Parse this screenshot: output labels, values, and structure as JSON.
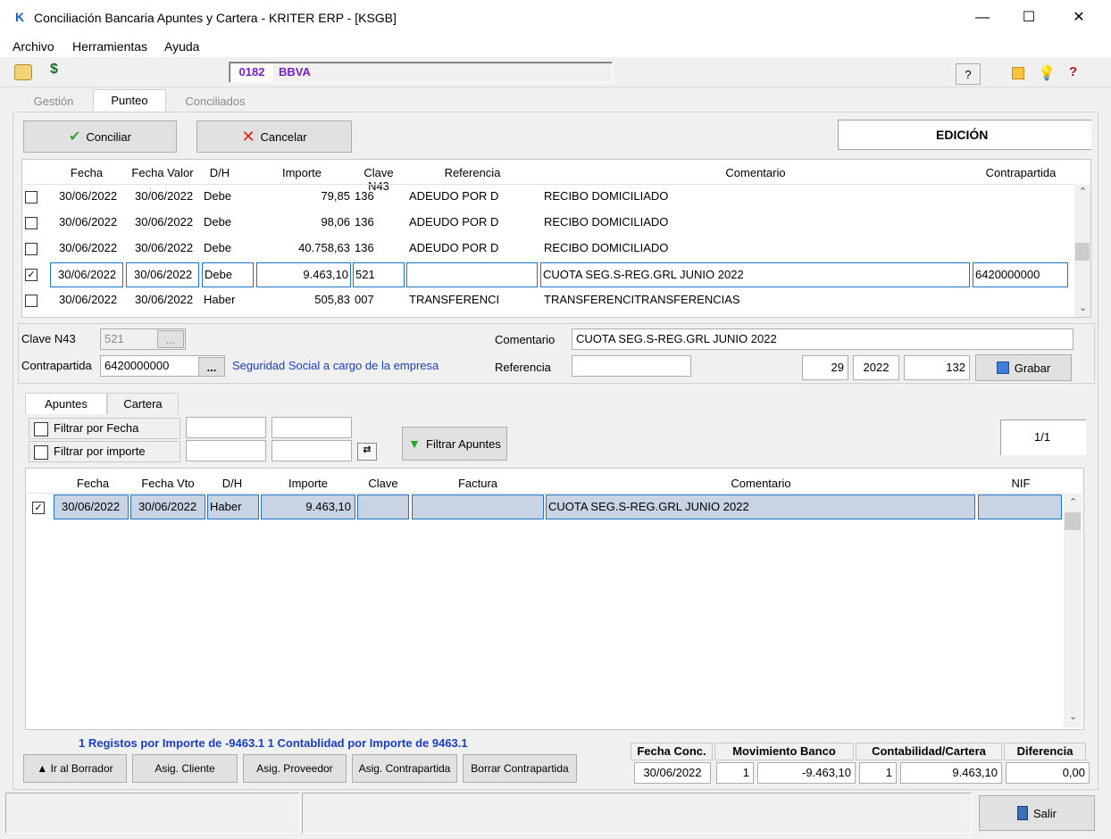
{
  "window": {
    "title": "Conciliación Bancaria Apuntes y Cartera - KRITER ERP - [KSGB]",
    "app_icon": "K",
    "minimize": "—",
    "maximize": "☐",
    "close": "✕"
  },
  "menu": [
    "Archivo",
    "Herramientas",
    "Ayuda"
  ],
  "toolbar": {
    "bank_code": "0182",
    "bank_name": "BBVA",
    "help_label": "?"
  },
  "main_tabs": [
    "Gestión",
    "Punteo",
    "Conciliados"
  ],
  "actions": {
    "conciliar": "Conciliar",
    "cancelar": "Cancelar",
    "mode": "EDICIÓN"
  },
  "bank_grid": {
    "headers": [
      "Fecha",
      "Fecha Valor",
      "D/H",
      "Importe",
      "Clave N43",
      "Referencia",
      "Comentario",
      "Contrapartida"
    ],
    "rows": [
      {
        "checked": false,
        "fecha": "30/06/2022",
        "fecha_valor": "30/06/2022",
        "dh": "Debe",
        "importe": "79,85",
        "clave": "136",
        "referencia": "ADEUDO POR D",
        "comentario": "RECIBO DOMICILIADO",
        "contrapartida": ""
      },
      {
        "checked": false,
        "fecha": "30/06/2022",
        "fecha_valor": "30/06/2022",
        "dh": "Debe",
        "importe": "98,06",
        "clave": "136",
        "referencia": "ADEUDO POR D",
        "comentario": "RECIBO DOMICILIADO",
        "contrapartida": ""
      },
      {
        "checked": false,
        "fecha": "30/06/2022",
        "fecha_valor": "30/06/2022",
        "dh": "Debe",
        "importe": "40.758,63",
        "clave": "136",
        "referencia": "ADEUDO POR D",
        "comentario": "RECIBO DOMICILIADO",
        "contrapartida": ""
      },
      {
        "checked": true,
        "fecha": "30/06/2022",
        "fecha_valor": "30/06/2022",
        "dh": "Debe",
        "importe": "9.463,10",
        "clave": "521",
        "referencia": "",
        "comentario": "CUOTA SEG.S-REG.GRL JUNIO 2022",
        "contrapartida": "6420000000"
      },
      {
        "checked": false,
        "fecha": "30/06/2022",
        "fecha_valor": "30/06/2022",
        "dh": "Haber",
        "importe": "505,83",
        "clave": "007",
        "referencia": "TRANSFERENCI",
        "comentario": "TRANSFERENCITRANSFERENCIAS",
        "contrapartida": ""
      }
    ]
  },
  "detail": {
    "clave_label": "Clave N43",
    "clave_value": "521",
    "browse": "...",
    "contrapartida_label": "Contrapartida",
    "contrapartida_value": "6420000000",
    "contrapartida_desc": "Seguridad Social a cargo de la empresa",
    "comentario_label": "Comentario",
    "comentario_value": "CUOTA SEG.S-REG.GRL JUNIO 2022",
    "referencia_label": "Referencia",
    "referencia_value": "",
    "num1": "29",
    "num2": "2022",
    "num3": "132",
    "grabar": "Grabar"
  },
  "sub_tabs": [
    "Apuntes",
    "Cartera"
  ],
  "filters": {
    "fecha_label": "Filtrar por Fecha",
    "importe_label": "Filtrar por importe",
    "filter_button": "Filtrar Apuntes",
    "page": "1/1"
  },
  "apuntes_grid": {
    "headers": [
      "Fecha",
      "Fecha Vto",
      "D/H",
      "Importe",
      "Clave",
      "Factura",
      "Comentario",
      "NIF"
    ],
    "rows": [
      {
        "checked": true,
        "fecha": "30/06/2022",
        "fecha_vto": "30/06/2022",
        "dh": "Haber",
        "importe": "9.463,10",
        "clave": "",
        "factura": "",
        "comentario": "CUOTA SEG.S-REG.GRL JUNIO 2022",
        "nif": ""
      }
    ]
  },
  "summary_text": "1 Registos por Importe de -9463.1 1 Contablidad por Importe de 9463.1",
  "bottom_buttons": [
    "▲ Ir al Borrador",
    "Asig. Cliente",
    "Asig. Proveedor",
    "Asig. Contrapartida",
    "Borrar Contrapartida"
  ],
  "totals": {
    "headers": [
      "Fecha Conc.",
      "Movimiento Banco",
      "Contabilidad/Cartera",
      "Diferencia"
    ],
    "fecha": "30/06/2022",
    "mov_count": "1",
    "mov_amount": "-9.463,10",
    "cont_count": "1",
    "cont_amount": "9.463,10",
    "diferencia": "0,00"
  },
  "footer": {
    "salir": "Salir"
  }
}
